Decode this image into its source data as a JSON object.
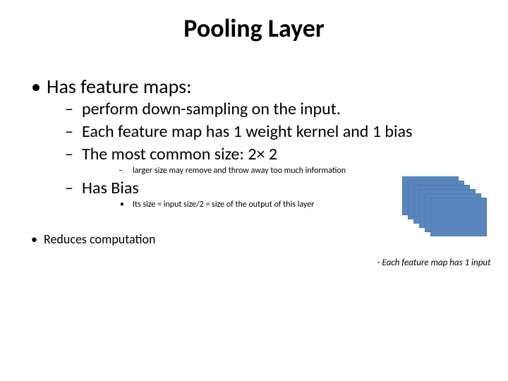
{
  "title": "Pooling Layer",
  "bullets": {
    "b1": "Has feature maps:",
    "b1_1": " perform down-sampling on the input.",
    "b1_2": " Each feature map has 1 weight kernel and 1 bias",
    "b1_3": "The most common size: 2× 2",
    "b1_3_1": "larger size may remove and throw away too much information",
    "b1_4": "Has Bias",
    "b1_4_1": "Its size = input size/2 = size  of the output of this layer",
    "b2": "Reduces computation"
  },
  "caption": "- Each feature map has 1 input"
}
